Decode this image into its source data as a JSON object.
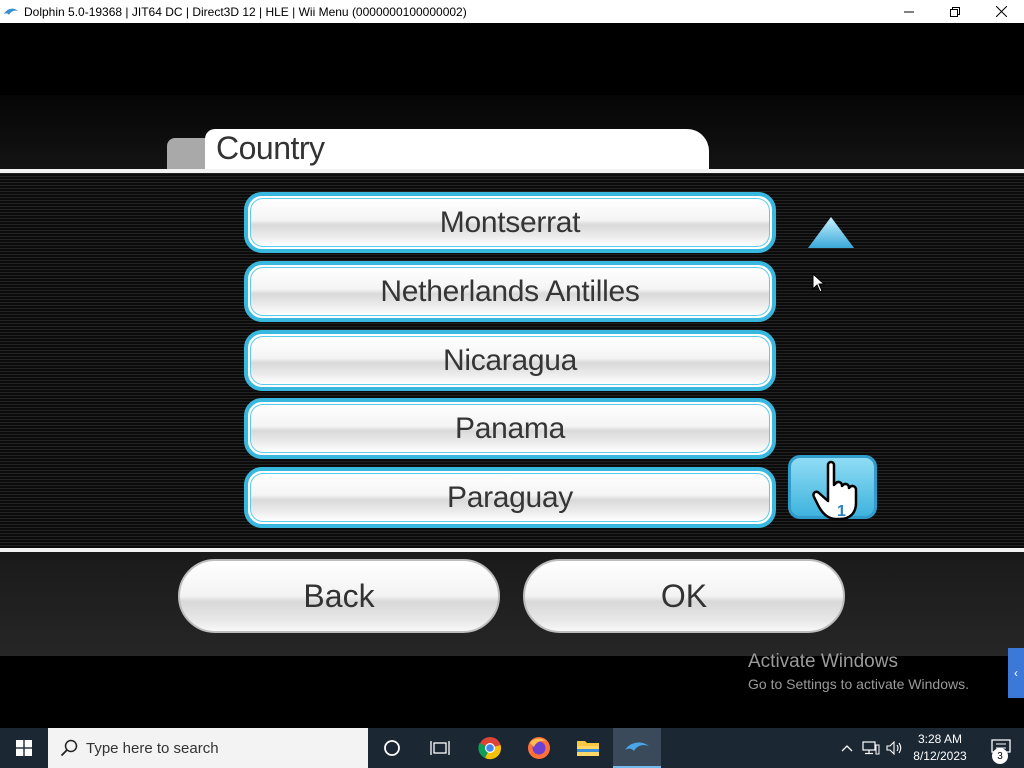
{
  "window": {
    "title": "Dolphin 5.0-19368 | JIT64 DC | Direct3D 12 | HLE | Wii Menu (0000000100000002)",
    "app_icon": "dolphin-icon"
  },
  "wii": {
    "header_title": "Country",
    "countries": [
      {
        "label": "Montserrat"
      },
      {
        "label": "Netherlands Antilles"
      },
      {
        "label": "Nicaragua"
      },
      {
        "label": "Panama"
      },
      {
        "label": "Paraguay"
      }
    ],
    "pointer_player": "1",
    "back_label": "Back",
    "ok_label": "OK",
    "accent_color": "#39b8df"
  },
  "watermark": {
    "title": "Activate Windows",
    "subtitle": "Go to Settings to activate Windows."
  },
  "taskbar": {
    "search_placeholder": "Type here to search",
    "time": "3:28 AM",
    "date": "8/12/2023",
    "notification_count": "3"
  }
}
